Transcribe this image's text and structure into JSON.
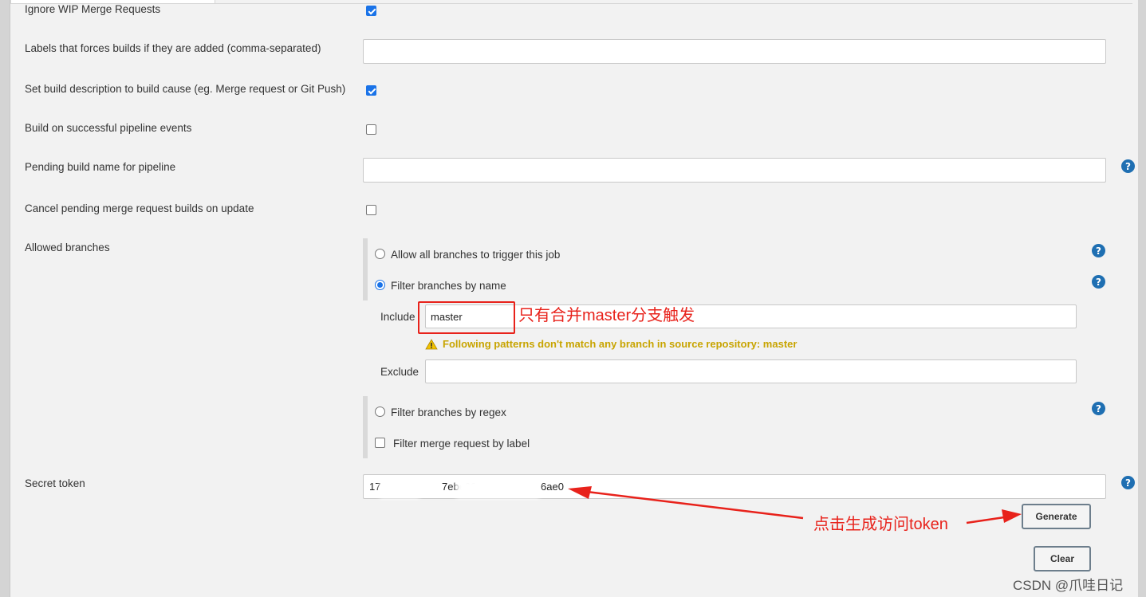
{
  "form": {
    "ignore_wip": {
      "label": "Ignore WIP Merge Requests",
      "checked": true
    },
    "labels_force": {
      "label": "Labels that forces builds if they are added (comma-separated)",
      "value": ""
    },
    "set_description": {
      "label": "Set build description to build cause (eg. Merge request or Git Push)",
      "checked": true
    },
    "build_pipeline": {
      "label": "Build on successful pipeline events",
      "checked": false
    },
    "pending_name": {
      "label": "Pending build name for pipeline",
      "value": ""
    },
    "cancel_pending": {
      "label": "Cancel pending merge request builds on update",
      "checked": false
    },
    "allowed_branches": {
      "label": "Allowed branches",
      "allow_all_label": "Allow all branches to trigger this job",
      "filter_name_label": "Filter branches by name",
      "include_label": "Include",
      "include_value": "master",
      "warning": "Following patterns don't match any branch in source repository: master",
      "exclude_label": "Exclude",
      "exclude_value": "",
      "filter_regex_label": "Filter branches by regex",
      "filter_label_label": "Filter merge request by label",
      "selected": "Filter branches by name"
    },
    "secret_token": {
      "label": "Secret token",
      "value_parts": [
        "17",
        "7ebe30",
        "6ae0"
      ],
      "generate_label": "Generate",
      "clear_label": "Clear"
    },
    "help_icon_glyph": "?"
  },
  "annotations": {
    "master_note": "只有合并master分支触发",
    "token_note": "点击生成访问token",
    "color": "#e8221b"
  },
  "watermark": "CSDN @爪哇日记",
  "colors": {
    "accent": "#1a73e8",
    "help": "#1f6fb2",
    "warning": "#c8a400"
  }
}
